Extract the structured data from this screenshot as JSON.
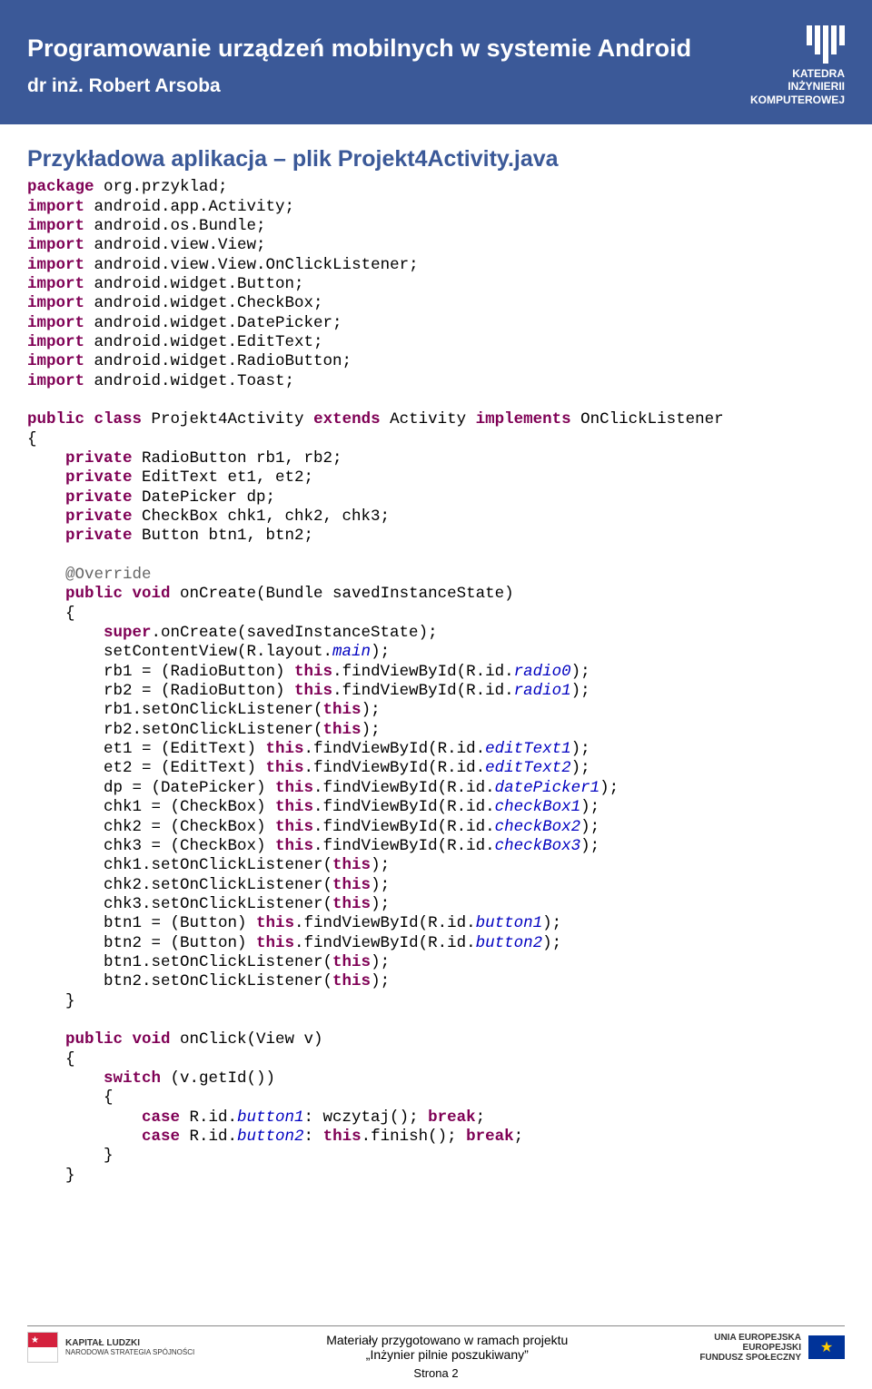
{
  "header": {
    "title": "Programowanie urządzeń mobilnych w systemie Android",
    "author": "dr inż. Robert Arsoba",
    "logo_line1": "KATEDRA",
    "logo_line2": "INŻYNIERII",
    "logo_line3": "KOMPUTEROWEJ"
  },
  "section_title": "Przykładowa aplikacja – plik Projekt4Activity.java",
  "code": {
    "pkg_kw": "package",
    "pkg": " org.przyklad;",
    "imp": "import",
    "imports": [
      " android.app.Activity;",
      " android.os.Bundle;",
      " android.view.View;",
      " android.view.View.OnClickListener;",
      " android.widget.Button;",
      " android.widget.CheckBox;",
      " android.widget.DatePicker;",
      " android.widget.EditText;",
      " android.widget.RadioButton;",
      " android.widget.Toast;"
    ],
    "cls1": "public class",
    "cls2": " Projekt4Activity ",
    "cls3": "extends",
    "cls4": " Activity ",
    "cls5": "implements",
    "cls6": " OnClickListener",
    "brace_open": "{",
    "brace_close": "}",
    "priv": "private",
    "fields": {
      "f1": " RadioButton rb1, rb2;",
      "f2": " EditText et1, et2;",
      "f3": " DatePicker dp;",
      "f4": " CheckBox chk1, chk2, chk3;",
      "f5": " Button btn1, btn2;"
    },
    "override": "@Override",
    "pubvoid": "public void",
    "oncreate_sig": " onCreate(Bundle savedInstanceState)",
    "super_kw": "super",
    "super_call": ".onCreate(savedInstanceState);",
    "scv1": "setContentView(R.layout.",
    "scv2": "main",
    "scv3": ");",
    "this_kw": "this",
    "assign": {
      "rb1a": "rb1 = (RadioButton) ",
      "rb1b": ".findViewById(R.id.",
      "rb1c": "radio0",
      "rb2a": "rb2 = (RadioButton) ",
      "rb2c": "radio1",
      "locl1": "rb1.setOnClickListener(",
      "locl2": "rb2.setOnClickListener(",
      "et1a": "et1 = (EditText) ",
      "et1c": "editText1",
      "et2a": "et2 = (EditText) ",
      "et2c": "editText2",
      "dpa": "dp = (DatePicker) ",
      "dpc": "datePicker1",
      "chk1a": "chk1 = (CheckBox) ",
      "chk1c": "checkBox1",
      "chk2a": "chk2 = (CheckBox) ",
      "chk2c": "checkBox2",
      "chk3a": "chk3 = (CheckBox) ",
      "chk3c": "checkBox3",
      "chkl1": "chk1.setOnClickListener(",
      "chkl2": "chk2.setOnClickListener(",
      "chkl3": "chk3.setOnClickListener(",
      "btn1a": "btn1 = (Button) ",
      "btn1c": "button1",
      "btn2a": "btn2 = (Button) ",
      "btn2c": "button2",
      "btnl1": "btn1.setOnClickListener(",
      "btnl2": "btn2.setOnClickListener("
    },
    "close_paren": ");",
    "onclick_sig": " onClick(View v)",
    "switch_kw": "switch",
    "switch_expr": " (v.getId())",
    "case_kw": "case",
    "case1a": " R.id.",
    "case1b": "button1",
    "case1c": ": wczytaj(); ",
    "case2b": "button2",
    "case2c": ": ",
    "case2d": ".finish(); ",
    "break_kw": "break",
    "semi": ";"
  },
  "footer": {
    "kapital1": "KAPITAŁ LUDZKI",
    "kapital2": "NARODOWA STRATEGIA SPÓJNOŚCI",
    "center1": "Materiały przygotowano w ramach projektu",
    "center2": "„Inżynier pilnie poszukiwany”",
    "eu1": "UNIA EUROPEJSKA",
    "eu2": "EUROPEJSKI",
    "eu3": "FUNDUSZ SPOŁECZNY",
    "page": "Strona 2"
  }
}
